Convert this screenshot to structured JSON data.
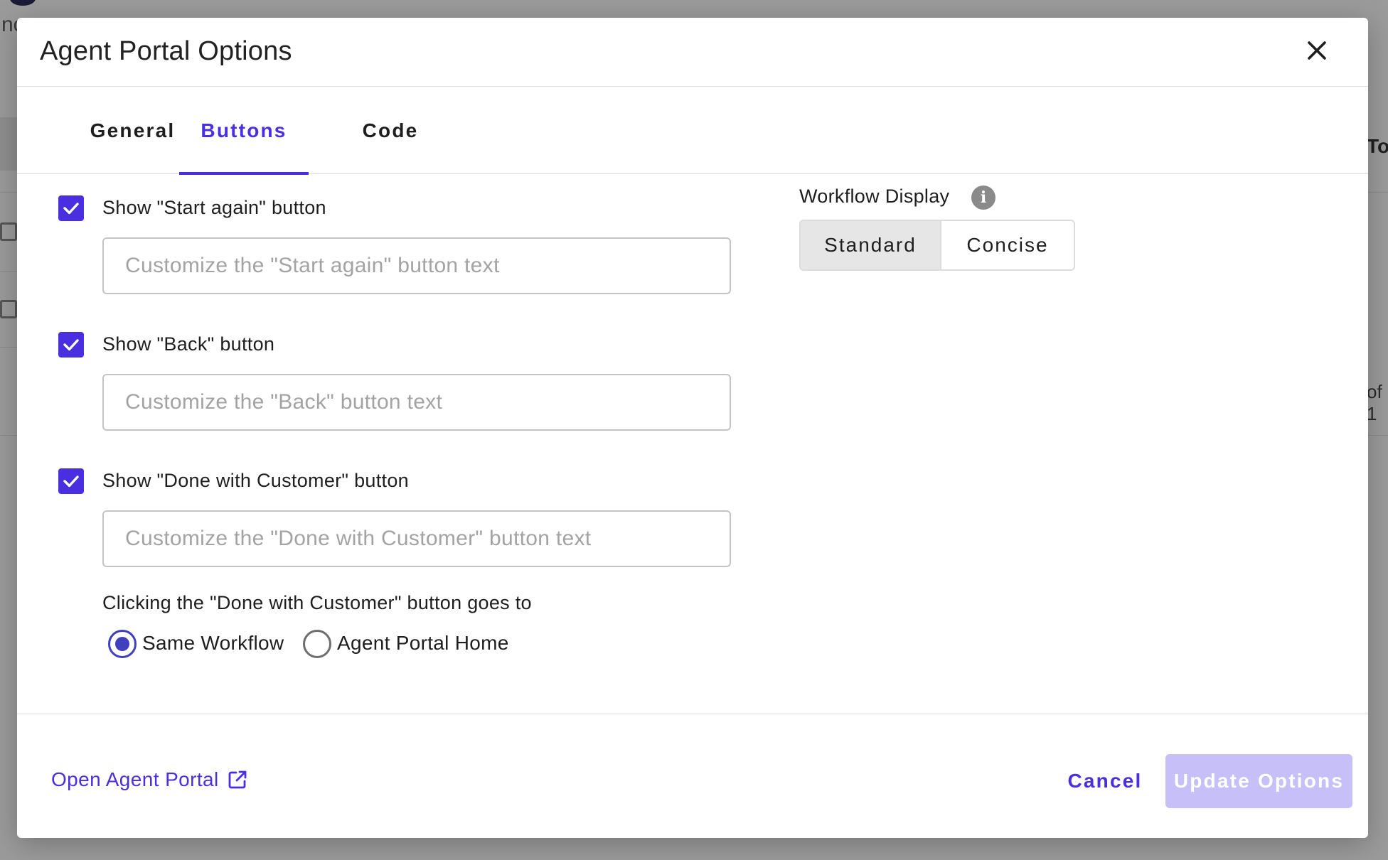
{
  "background": {
    "fragment_top_left": "nc",
    "fragment_right_top": "To",
    "fragment_right_mid": "of 1"
  },
  "modal": {
    "title": "Agent Portal Options",
    "close_icon": "close-icon"
  },
  "tabs": [
    {
      "label": "General",
      "active": false
    },
    {
      "label": "Buttons",
      "active": true
    },
    {
      "label": "Code",
      "active": false
    }
  ],
  "buttons_tab": {
    "start_again": {
      "checked": true,
      "label": "Show \"Start again\" button",
      "placeholder": "Customize the \"Start again\" button text",
      "value": ""
    },
    "back": {
      "checked": true,
      "label": "Show \"Back\" button",
      "placeholder": "Customize the \"Back\" button text",
      "value": ""
    },
    "done": {
      "checked": true,
      "label": "Show \"Done with Customer\" button",
      "placeholder": "Customize the \"Done with Customer\" button text",
      "value": ""
    },
    "goes_to": {
      "label": "Clicking the \"Done with Customer\" button goes to",
      "options": [
        {
          "label": "Same Workflow",
          "selected": true
        },
        {
          "label": "Agent Portal Home",
          "selected": false
        }
      ]
    },
    "workflow_display": {
      "label": "Workflow Display",
      "info_icon": "info-icon",
      "options": [
        {
          "label": "Standard",
          "selected": true
        },
        {
          "label": "Concise",
          "selected": false
        }
      ]
    }
  },
  "footer": {
    "open_link": "Open Agent Portal",
    "open_link_icon": "external-link-icon",
    "cancel": "Cancel",
    "update": "Update Options",
    "update_disabled": true
  },
  "colors": {
    "accent": "#4a2fe0",
    "radio_selected": "#3f3fbf",
    "update_disabled_bg": "#c7bff8",
    "overlay": "#9a9a9a"
  }
}
